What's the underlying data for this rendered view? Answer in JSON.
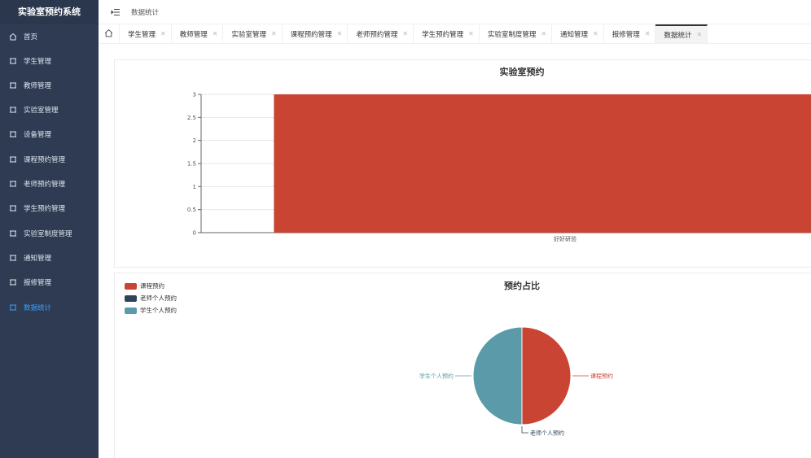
{
  "app": {
    "title": "实验室预约系统"
  },
  "sidebar": {
    "items": [
      {
        "label": "首页",
        "icon": "home-icon"
      },
      {
        "label": "学生管理",
        "icon": "menu-icon"
      },
      {
        "label": "教师管理",
        "icon": "menu-icon"
      },
      {
        "label": "实验室管理",
        "icon": "menu-icon"
      },
      {
        "label": "设备管理",
        "icon": "menu-icon"
      },
      {
        "label": "课程预约管理",
        "icon": "menu-icon"
      },
      {
        "label": "老师预约管理",
        "icon": "menu-icon"
      },
      {
        "label": "学生预约管理",
        "icon": "menu-icon"
      },
      {
        "label": "实验室制度管理",
        "icon": "menu-icon"
      },
      {
        "label": "通知管理",
        "icon": "menu-icon"
      },
      {
        "label": "报修管理",
        "icon": "menu-icon"
      },
      {
        "label": "数据统计",
        "icon": "menu-icon",
        "active": true
      }
    ]
  },
  "header": {
    "breadcrumb": "数据统计"
  },
  "tabs": [
    {
      "label": "学生管理"
    },
    {
      "label": "教师管理"
    },
    {
      "label": "实验室管理"
    },
    {
      "label": "课程预约管理"
    },
    {
      "label": "老师预约管理"
    },
    {
      "label": "学生预约管理"
    },
    {
      "label": "实验室制度管理"
    },
    {
      "label": "通知管理"
    },
    {
      "label": "报修管理"
    },
    {
      "label": "数据统计",
      "active": true
    }
  ],
  "chart_data": [
    {
      "type": "bar",
      "title": "实验室预约",
      "categories": [
        "好好研验"
      ],
      "values": [
        3
      ],
      "ylim": [
        0,
        3
      ],
      "yticks": [
        "0",
        "0.5",
        "1",
        "1.5",
        "2",
        "2.5",
        "3"
      ],
      "color": "#c94432",
      "grid": true
    },
    {
      "type": "pie",
      "title": "预约占比",
      "legend_position": "top-left",
      "slices": [
        {
          "name": "课程预约",
          "value": 1,
          "color": "#c94432"
        },
        {
          "name": "老师个人预约",
          "value": 0,
          "color": "#2f4459"
        },
        {
          "name": "学生个人预约",
          "value": 1,
          "color": "#5b9aa8"
        }
      ]
    }
  ]
}
